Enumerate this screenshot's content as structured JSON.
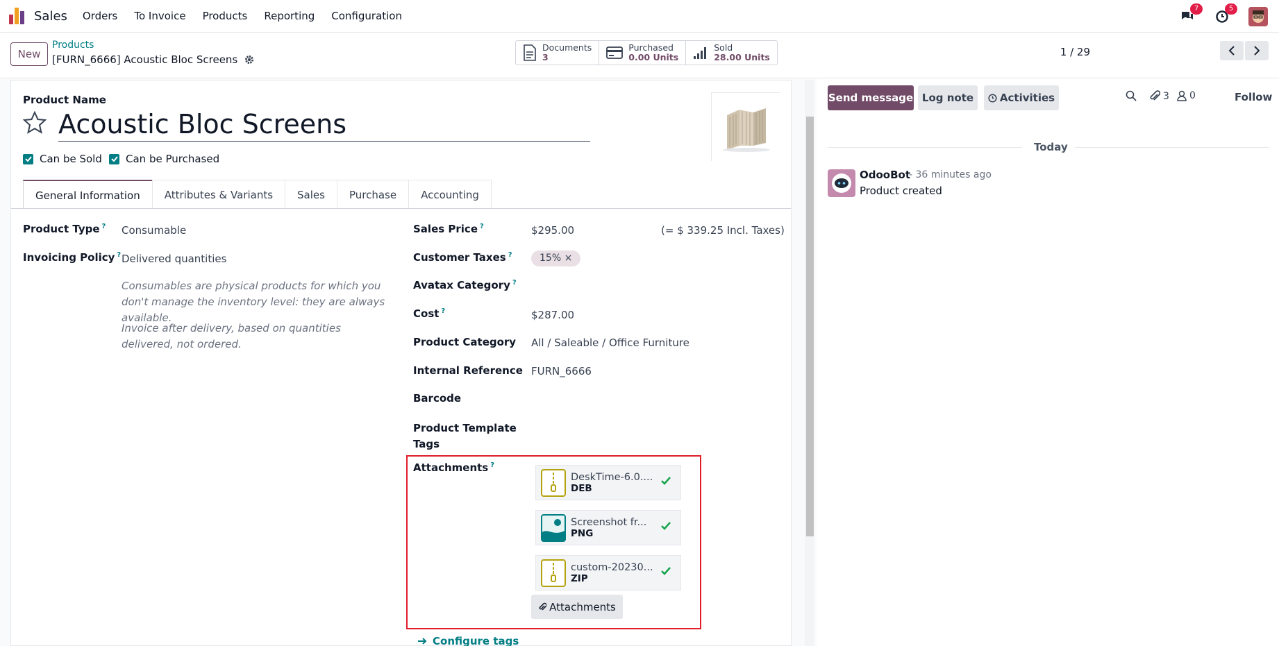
{
  "navbar": {
    "app_name": "Sales",
    "menu": [
      "Orders",
      "To Invoice",
      "Products",
      "Reporting",
      "Configuration"
    ],
    "messages_badge": "7",
    "activities_badge": "5"
  },
  "control": {
    "new_label": "New",
    "breadcrumb_parent": "Products",
    "breadcrumb_current": "[FURN_6666] Acoustic Bloc Screens",
    "smart_buttons": [
      {
        "label": "Documents",
        "value": "3"
      },
      {
        "label": "Purchased",
        "value": "0.00 Units"
      },
      {
        "label": "Sold",
        "value": "28.00 Units"
      }
    ],
    "pager": "1 / 29"
  },
  "form": {
    "name_label": "Product Name",
    "name": "Acoustic Bloc Screens",
    "can_be_sold": "Can be Sold",
    "can_be_purchased": "Can be Purchased",
    "tabs": [
      "General Information",
      "Attributes & Variants",
      "Sales",
      "Purchase",
      "Accounting"
    ],
    "active_tab": "General Information",
    "left": {
      "product_type_label": "Product Type",
      "product_type": "Consumable",
      "invoicing_policy_label": "Invoicing Policy",
      "invoicing_policy": "Delivered quantities",
      "help_consumable": "Consumables are physical products for which you don't manage the inventory level: they are always available.",
      "help_invoice": "Invoice after delivery, based on quantities delivered, not ordered."
    },
    "right": {
      "sales_price_label": "Sales Price",
      "sales_price": "$295.00",
      "sales_price_incl": "(= $ 339.25 Incl. Taxes)",
      "customer_taxes_label": "Customer Taxes",
      "customer_taxes_tag": "15% ×",
      "avatax_label": "Avatax Category",
      "cost_label": "Cost",
      "cost": "$287.00",
      "category_label": "Product Category",
      "category": "All / Saleable / Office Furniture",
      "internal_ref_label": "Internal Reference",
      "internal_ref": "FURN_6666",
      "barcode_label": "Barcode",
      "template_tags_label_1": "Product Template",
      "template_tags_label_2": "Tags",
      "attachments_label": "Attachments",
      "attachments": [
        {
          "name": "DeskTime-6.0....",
          "ext": "DEB",
          "icon": "archive-icon"
        },
        {
          "name": "Screenshot fr...",
          "ext": "PNG",
          "icon": "image-icon"
        },
        {
          "name": "custom-20230...",
          "ext": "ZIP",
          "icon": "archive-icon"
        }
      ],
      "attach_button": "Attachments",
      "configure_tags": "Configure tags"
    }
  },
  "chatter": {
    "send_message": "Send message",
    "log_note": "Log note",
    "activities": "Activities",
    "attachment_count": "3",
    "follower_count": "0",
    "follow": "Follow",
    "today": "Today",
    "message": {
      "author": "OdooBot",
      "time": "- 36 minutes ago",
      "body": "Product created"
    }
  },
  "colors": {
    "brand": "#714b67",
    "link": "#017e84",
    "highlight": "#e11d2b"
  }
}
